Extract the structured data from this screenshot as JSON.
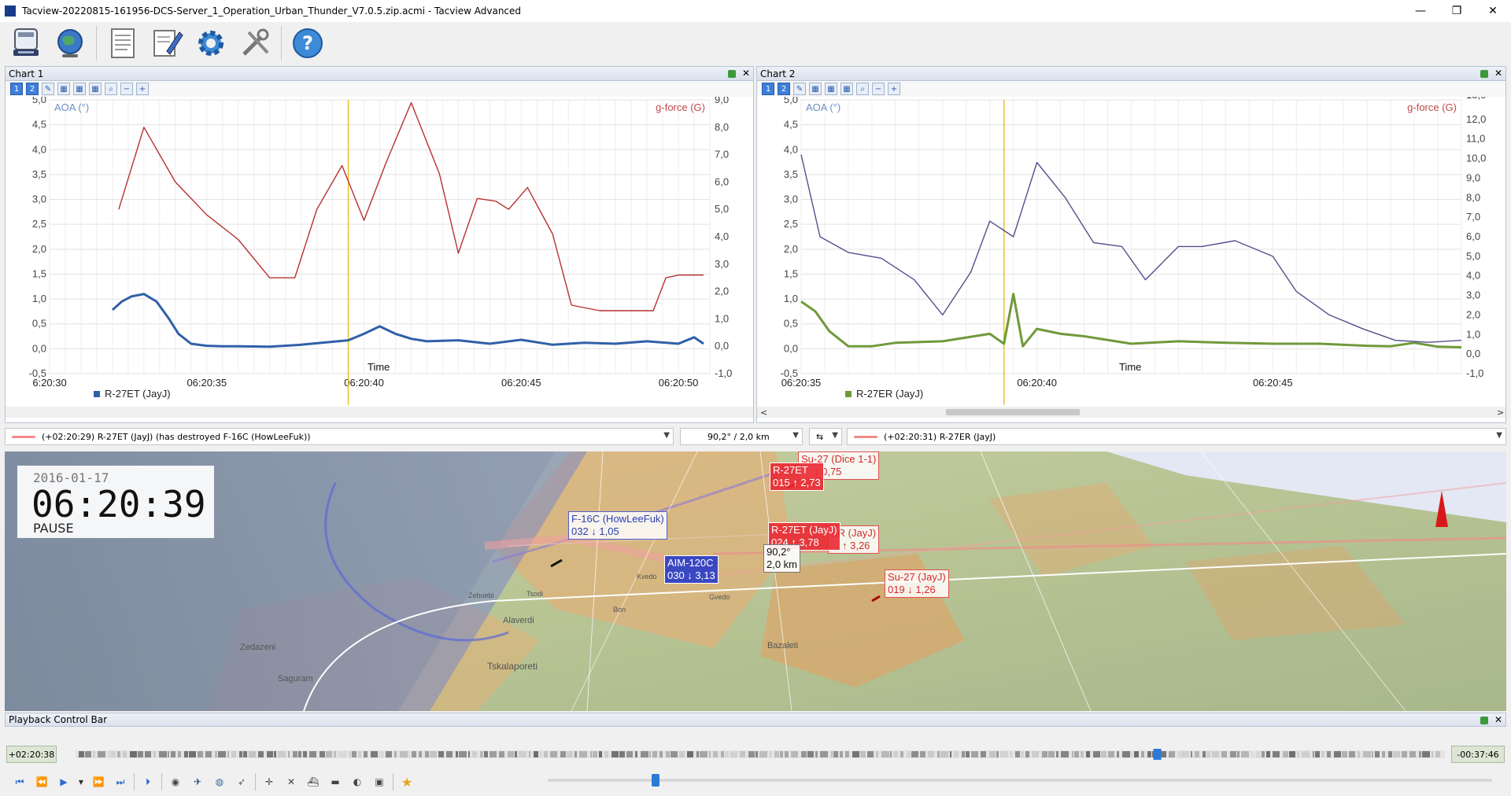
{
  "window": {
    "title": "Tacview-20220815-161956-DCS-Server_1_Operation_Urban_Thunder_V7.0.5.zip.acmi - Tacview Advanced",
    "minimize": "—",
    "maximize": "❐",
    "close": "✕"
  },
  "toolbar": {
    "icons": [
      "recorder-icon",
      "globe-icon",
      "document-icon",
      "notepad-icon",
      "settings-gear-icon",
      "tools-icon",
      "help-icon"
    ]
  },
  "chart1": {
    "title": "Chart 1",
    "tools": [
      "1",
      "2"
    ],
    "left_axis_label": "AOA (°)",
    "right_axis_label": "g-force (G)",
    "x_axis_label": "Time",
    "legend": "R-27ET (JayJ)",
    "left_ticks": [
      "5,0",
      "4,5",
      "4,0",
      "3,5",
      "3,0",
      "2,5",
      "2,0",
      "1,5",
      "1,0",
      "0,5",
      "0,0",
      "-0,5"
    ],
    "right_ticks": [
      "9,0",
      "8,0",
      "7,0",
      "6,0",
      "5,0",
      "4,0",
      "3,0",
      "2,0",
      "1,0",
      "0,0",
      "-1,0"
    ],
    "x_ticks": [
      "6:20:30",
      "06:20:35",
      "06:20:40",
      "06:20:45",
      "06:20:50"
    ]
  },
  "chart2": {
    "title": "Chart 2",
    "tools": [
      "1",
      "2"
    ],
    "left_axis_label": "AOA (°)",
    "right_axis_label": "g-force (G)",
    "x_axis_label": "Time",
    "legend": "R-27ER (JayJ)",
    "left_ticks": [
      "5,0",
      "4,5",
      "4,0",
      "3,5",
      "3,0",
      "2,5",
      "2,0",
      "1,5",
      "1,0",
      "0,5",
      "0,0",
      "-0,5"
    ],
    "right_ticks": [
      "12,0",
      "11,0",
      "10,0",
      "9,0",
      "8,0",
      "7,0",
      "6,0",
      "5,0",
      "4,0",
      "3,0",
      "2,0",
      "1,0",
      "0,0",
      "-1,0"
    ],
    "right_top_partial": "13,0",
    "x_ticks": [
      "06:20:35",
      "06:20:40",
      "06:20:45"
    ]
  },
  "chart_data": [
    {
      "type": "line",
      "title": "",
      "xlabel": "Time",
      "ylabel": "AOA (°)",
      "y2label": "g-force (G)",
      "xlim": [
        "06:20:30",
        "06:20:51"
      ],
      "ylim": [
        -0.5,
        5.0
      ],
      "y2lim": [
        -1.0,
        9.0
      ],
      "series": [
        {
          "name": "R-27ET (JayJ)",
          "axis": "left",
          "color": "#3060a8",
          "x": [
            32.0,
            32.3,
            32.6,
            33.0,
            33.4,
            33.8,
            34.1,
            34.5,
            35.0,
            35.5,
            36.0,
            37.0,
            38.0,
            39.0,
            39.5,
            40.0,
            40.5,
            41.0,
            41.5,
            42.0,
            43.0,
            44.0,
            45.0,
            46.0,
            47.0,
            48.0,
            49.0,
            50.0,
            50.5,
            50.8
          ],
          "y": [
            0.78,
            0.95,
            1.05,
            1.1,
            0.95,
            0.6,
            0.3,
            0.1,
            0.06,
            0.05,
            0.05,
            0.04,
            0.08,
            0.14,
            0.17,
            0.3,
            0.45,
            0.3,
            0.2,
            0.15,
            0.17,
            0.1,
            0.18,
            0.08,
            0.12,
            0.1,
            0.15,
            0.1,
            0.23,
            0.1
          ]
        },
        {
          "name": "g-force",
          "axis": "right",
          "color": "#b83030",
          "x": [
            32.2,
            33.0,
            34.0,
            35.0,
            36.0,
            37.0,
            37.8,
            38.5,
            39.3,
            40.0,
            40.7,
            41.5,
            42.4,
            43.0,
            43.6,
            44.2,
            44.6,
            45.2,
            46.0,
            46.6,
            47.5,
            48.5,
            49.2,
            49.6,
            50.0,
            50.8
          ],
          "y": [
            5.0,
            8.0,
            6.0,
            4.8,
            3.9,
            2.5,
            2.5,
            5.0,
            6.6,
            4.6,
            6.7,
            8.9,
            6.3,
            3.4,
            5.4,
            5.3,
            5.0,
            5.8,
            4.1,
            1.5,
            1.3,
            1.3,
            1.3,
            2.5,
            2.6,
            2.6
          ]
        }
      ]
    },
    {
      "type": "line",
      "title": "",
      "xlabel": "Time",
      "ylabel": "AOA (°)",
      "y2label": "g-force (G)",
      "xlim": [
        "06:20:35",
        "06:20:49"
      ],
      "ylim": [
        -0.5,
        5.0
      ],
      "y2lim": [
        -1.0,
        13.0
      ],
      "series": [
        {
          "name": "R-27ER (JayJ)",
          "axis": "left",
          "color": "#6f9a3a",
          "x": [
            35.0,
            35.3,
            35.6,
            36.0,
            36.5,
            37.0,
            38.0,
            39.0,
            39.3,
            39.5,
            39.7,
            40.0,
            40.5,
            41.0,
            42.0,
            43.0,
            44.0,
            45.0,
            46.0,
            47.0,
            47.5,
            48.0,
            48.5,
            49.0
          ],
          "y": [
            0.95,
            0.75,
            0.35,
            0.05,
            0.05,
            0.12,
            0.15,
            0.3,
            0.1,
            1.1,
            0.05,
            0.4,
            0.3,
            0.25,
            0.1,
            0.15,
            0.12,
            0.1,
            0.1,
            0.06,
            0.05,
            0.12,
            0.04,
            0.03
          ]
        },
        {
          "name": "g-force",
          "axis": "right",
          "color": "#544f8c",
          "x": [
            35.0,
            35.4,
            36.0,
            36.7,
            37.4,
            38.0,
            38.6,
            39.0,
            39.5,
            40.0,
            40.6,
            41.2,
            41.8,
            42.3,
            43.0,
            43.5,
            44.2,
            45.0,
            45.5,
            46.2,
            46.9,
            47.6,
            48.3,
            49.0
          ],
          "y": [
            10.2,
            6.0,
            5.2,
            4.9,
            3.8,
            2.0,
            4.2,
            6.8,
            6.0,
            9.8,
            8.0,
            5.7,
            5.5,
            3.8,
            5.5,
            5.5,
            5.8,
            5.0,
            3.2,
            2.0,
            1.3,
            0.7,
            0.6,
            0.7
          ]
        }
      ]
    }
  ],
  "events": {
    "left": "(+02:20:29) R-27ET (JayJ) (has destroyed F-16C (HowLeeFuk))",
    "middle": "90,2° / 2,0 km",
    "right": "(+02:20:31) R-27ER (JayJ)"
  },
  "view3d": {
    "date": "2016-01-17",
    "time": "06:20:39",
    "state": "PAUSE",
    "labels": [
      {
        "line1": "Su-27 (Dice 1-1)",
        "line2": "↓ 0,75"
      },
      {
        "line1": "R-27ET",
        "line2": "015 ↑ 2,73"
      },
      {
        "line1": "F-16C (HowLeeFuk)",
        "line2": "032 ↓ 1,05"
      },
      {
        "line1": "R-27ET (JayJ)",
        "line2": "024 ↑ 3,78"
      },
      {
        "line1": "ER (JayJ)",
        "line2": "↑ 3,26"
      },
      {
        "line1": "AIM-120C",
        "line2": "030 ↓ 3,13"
      },
      {
        "line1": "90,2°",
        "line2": "2,0 km"
      },
      {
        "line1": "Su-27 (JayJ)",
        "line2": "019 ↓ 1,26"
      }
    ],
    "places": [
      "Kvedo",
      "Tsodi",
      "Zebuebi",
      "Alaverdi",
      "Bon",
      "Gvedo",
      "Bazaleti",
      "Tskalaporeti",
      "Zedazeni",
      "Saguram"
    ]
  },
  "playback": {
    "title": "Playback Control Bar",
    "elapsed": "+02:20:38",
    "remaining": "-00:37:46",
    "progress": 0.79
  }
}
